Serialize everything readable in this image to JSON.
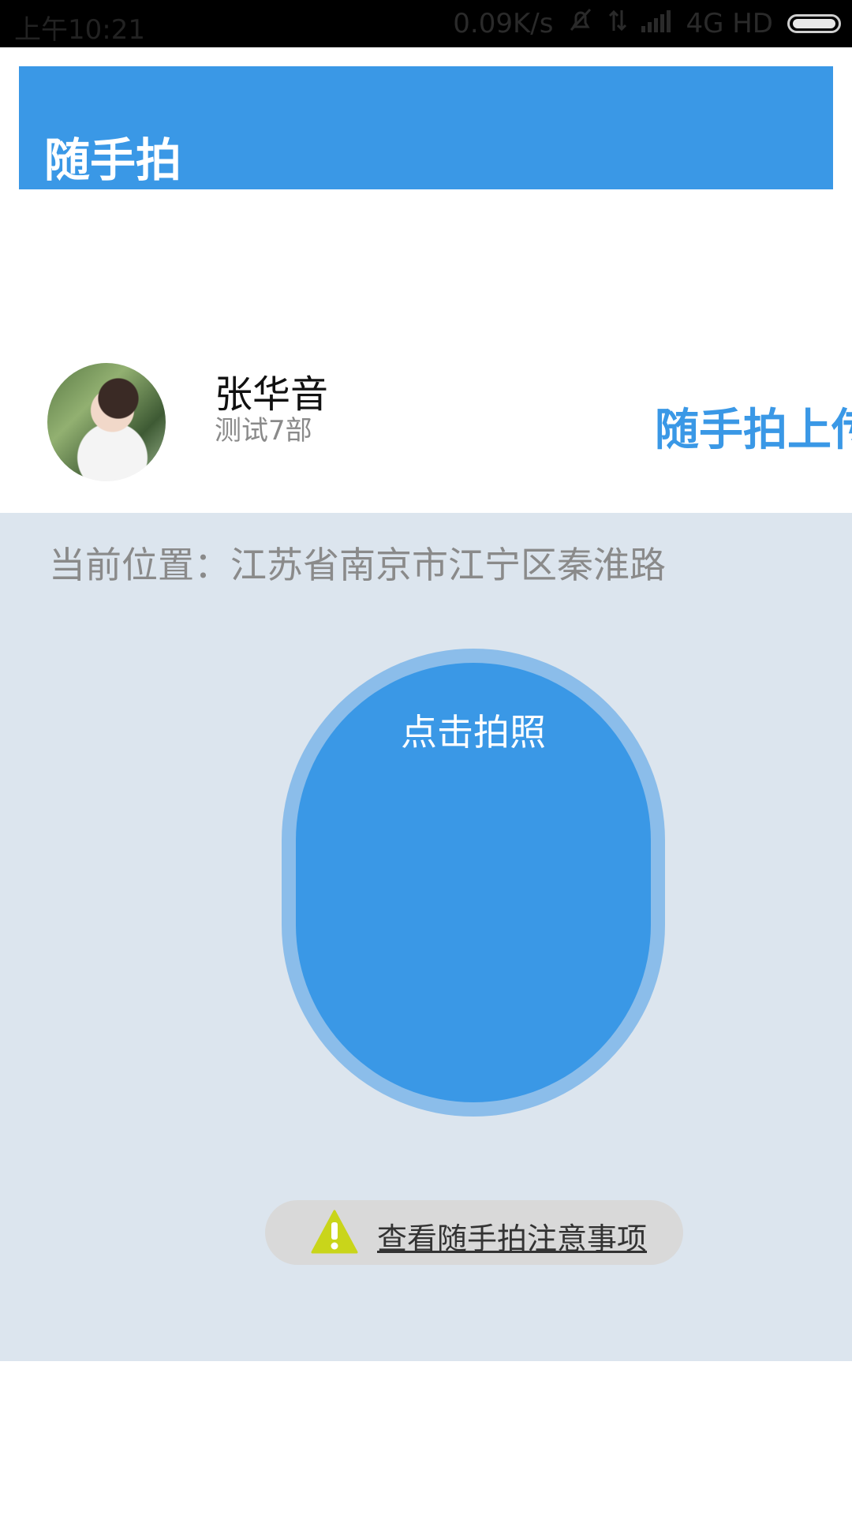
{
  "status_bar": {
    "time": "上午10:21",
    "speed": "0.09K/s",
    "network": "4G HD"
  },
  "app_bar": {
    "title": "随手拍"
  },
  "profile": {
    "name": "张华音",
    "department": "测试7部",
    "upload_link": "随手拍上传"
  },
  "main": {
    "location": "当前位置：江苏省南京市江宁区秦淮路",
    "photo_button": "点击拍照",
    "notice_link": "查看随手拍注意事项"
  },
  "colors": {
    "primary": "#3a98e6",
    "background": "#dce5ee",
    "warning": "#c9d51a"
  }
}
